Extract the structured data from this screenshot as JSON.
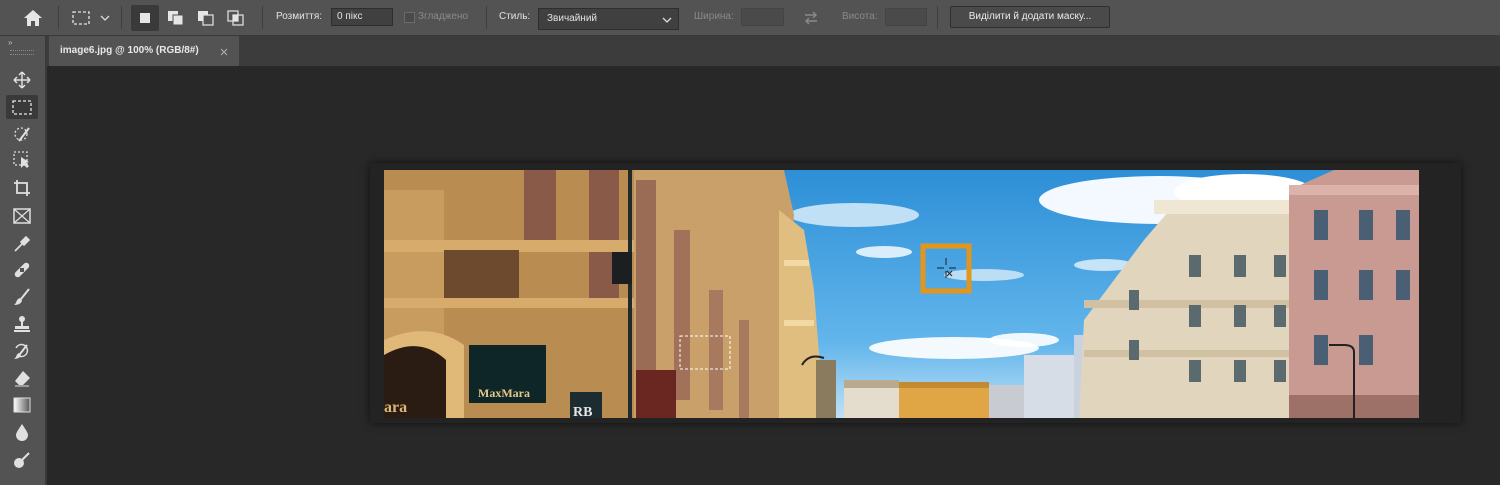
{
  "options_bar": {
    "feather_label": "Розмиття:",
    "feather_value": "0 пікс",
    "antialias_label": "Згладжено",
    "style_label": "Стиль:",
    "style_value": "Звичайний",
    "width_label": "Ширина:",
    "height_label": "Висота:",
    "select_mask_button": "Виділити й додати маску..."
  },
  "document_tab": {
    "title": "image6.jpg @ 100% (RGB/8#)"
  },
  "photo_signs": {
    "maxmara": "MaxMara",
    "ara": "ara",
    "rb": "RB"
  },
  "colors": {
    "highlight": "#e3951c",
    "sky": "#2d8fd6"
  }
}
